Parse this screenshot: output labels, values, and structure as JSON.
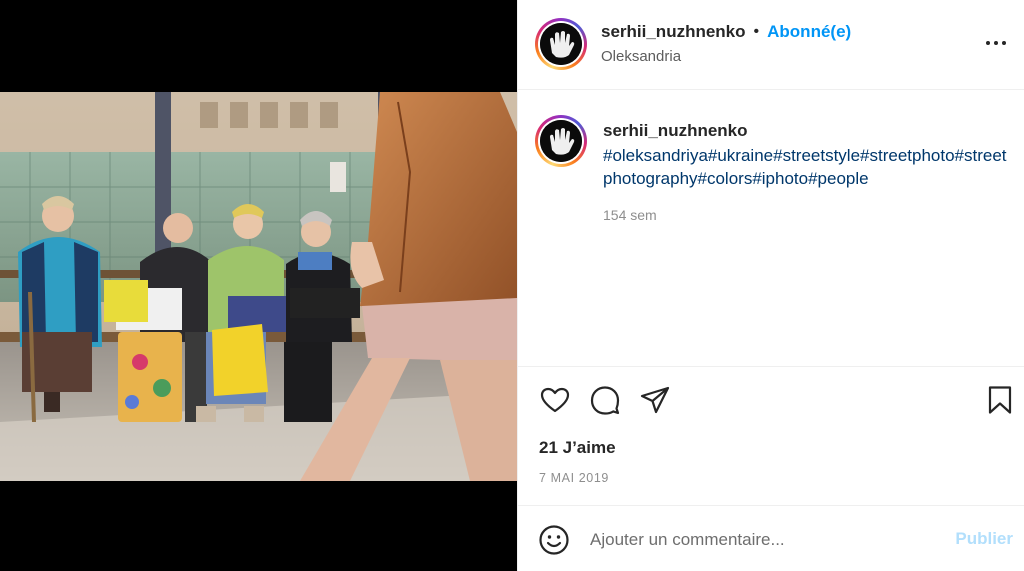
{
  "post": {
    "username": "serhii_nuzhnenko",
    "follow_status": "Abonné(e)",
    "separator": "•",
    "location": "Oleksandria"
  },
  "caption": {
    "username": "serhii_nuzhnenko",
    "hashtags": "#oleksandriya#ukraine#streetstyle#streetphoto#streetphotography#colors#iphoto#people",
    "time_ago": "154 sem"
  },
  "engagement": {
    "likes": "21 J’aime",
    "date": "7 MAI 2019"
  },
  "comment": {
    "placeholder": "Ajouter un commentaire...",
    "publish_label": "Publier"
  },
  "icons": {
    "like": "heart-icon",
    "comment": "comment-bubble-icon",
    "share": "paper-plane-icon",
    "save": "bookmark-icon",
    "more": "more-options-icon",
    "emoji": "smiley-icon"
  },
  "colors": {
    "link_blue": "#0095f6",
    "hashtag": "#00376b",
    "publish_disabled": "#b2dffc",
    "secondary_text": "#8e8e8e"
  }
}
